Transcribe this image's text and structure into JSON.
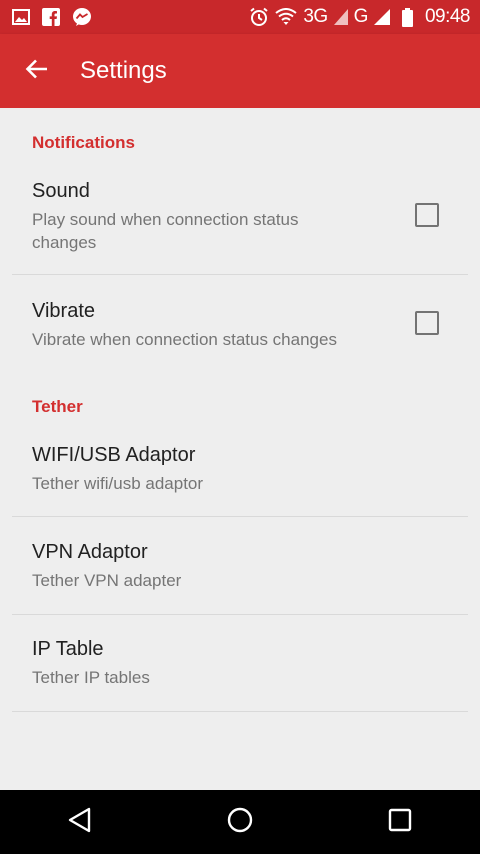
{
  "status_bar": {
    "network_3g": "3G",
    "network_g": "G",
    "time": "09:48",
    "icons": [
      "gallery-icon",
      "facebook-icon",
      "messenger-icon",
      "alarm-icon",
      "wifi-icon",
      "signal-icon",
      "battery-icon"
    ]
  },
  "app_bar": {
    "title": "Settings",
    "back_icon": "arrow-back-icon"
  },
  "sections": [
    {
      "header": "Notifications",
      "items": [
        {
          "title": "Sound",
          "summary": "Play sound when connection status changes",
          "checked": false
        },
        {
          "title": "Vibrate",
          "summary": "Vibrate when connection status changes",
          "checked": false
        }
      ]
    },
    {
      "header": "Tether",
      "items": [
        {
          "title": "WIFI/USB Adaptor",
          "summary": "Tether wifi/usb adaptor"
        },
        {
          "title": "VPN Adaptor",
          "summary": "Tether VPN adapter"
        },
        {
          "title": "IP Table",
          "summary": "Tether IP tables"
        }
      ]
    }
  ],
  "nav_bar": {
    "icons": [
      "back-triangle-icon",
      "home-circle-icon",
      "recents-square-icon"
    ]
  },
  "colors": {
    "primary": "#d32f2f",
    "status_bar": "#c8282b",
    "background": "#eeeeee",
    "title_text": "#212121",
    "summary_text": "#757575"
  }
}
